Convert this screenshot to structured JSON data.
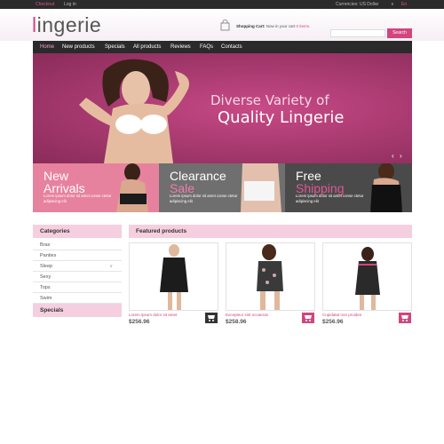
{
  "topbar": {
    "checkout": "Checkout",
    "login": "Log in",
    "currency": "Currencies: US Dollar",
    "chevron": "∨",
    "lang": "En"
  },
  "header": {
    "logo_first": "l",
    "logo_rest": "ingerie",
    "cart_title": "Shopping Cart:",
    "cart_text": "Now in your cart",
    "cart_count": "0 items.",
    "search_placeholder": "",
    "search_label": "Search"
  },
  "nav": {
    "items": [
      "Home",
      "New products",
      "Specials",
      "All products",
      "Reviews",
      "FAQs",
      "Contacts"
    ]
  },
  "hero": {
    "line1": "Diverse Variety of",
    "line2": "Quality Lingerie",
    "prev": "‹",
    "next": "›"
  },
  "promos": [
    {
      "t1": "New",
      "t2": "Arrivals",
      "desc": "Lorem ipsum dolor sit amet conse ctetur adipiscing elit"
    },
    {
      "t1": "Clearance",
      "t2": "Sale",
      "desc": "Lorem ipsum dolor sit amet conse ctetur adipiscing elit"
    },
    {
      "t1": "Free",
      "t2": "Shipping",
      "desc": "Lorem ipsum dolor sit amet conse ctetur adipiscing elit"
    }
  ],
  "sidebar": {
    "categories_title": "Categories",
    "categories": [
      "Bras",
      "Panties",
      "Sleep",
      "Sexy",
      "Tops",
      "Swim"
    ],
    "expand_chevron": "∨",
    "specials_title": "Specials"
  },
  "featured": {
    "title": "Featured products",
    "products": [
      {
        "name": "Lorem ipsum dolor sit amet",
        "price": "$256.96"
      },
      {
        "name": "Excepteur sint occaecat",
        "price": "$258.96"
      },
      {
        "name": "Cupidatat non proiden",
        "price": "$256.96"
      }
    ]
  },
  "colors": {
    "accent": "#d2457f",
    "nav_bg": "#2a2a2a",
    "header_pink": "#f5cfe0"
  }
}
